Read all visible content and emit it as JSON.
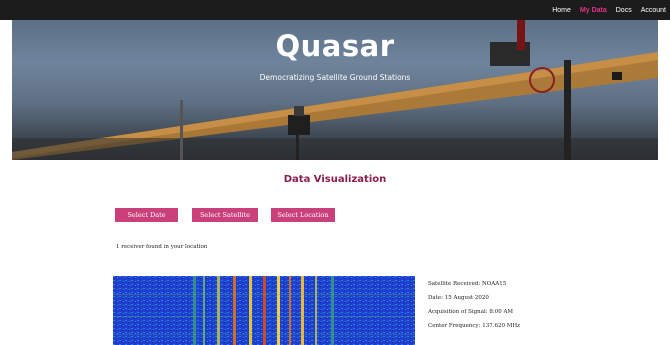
{
  "nav": {
    "items": [
      {
        "label": "Home",
        "active": false
      },
      {
        "label": "My Data",
        "active": true
      },
      {
        "label": "Docs",
        "active": false
      },
      {
        "label": "Account",
        "active": false
      }
    ],
    "active_color": "#e0318a"
  },
  "hero": {
    "title": "Quasar",
    "subtitle": "Democratizing Satellite Ground Stations"
  },
  "section": {
    "title": "Data Visualization"
  },
  "filters": {
    "date_label": "Select Date",
    "satellite_label": "Select Satellite",
    "location_label": "Select Location",
    "button_color": "#c9407a"
  },
  "results": {
    "receiver_text": "1 receiver found in your location"
  },
  "details": {
    "satellite": "Satellite Received: NOAA15",
    "date": "Date: 15 August 2020",
    "aos": "Acquisition of Signal: 8:00 AM",
    "frequency": "Center Frequency: 137.620 MHz"
  },
  "colors": {
    "accent": "#8b1d4f",
    "topbar": "#1c1c1c"
  }
}
